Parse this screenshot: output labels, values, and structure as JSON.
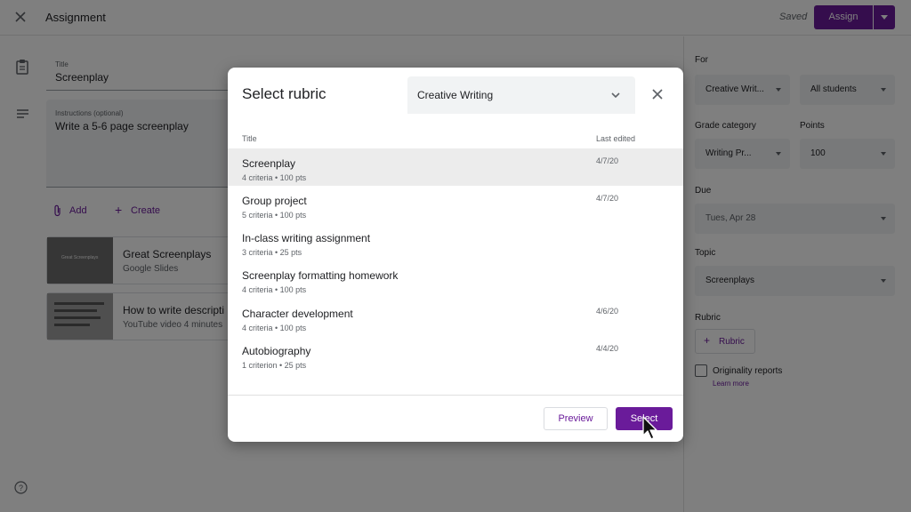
{
  "topbar": {
    "title": "Assignment",
    "saved": "Saved",
    "assign_label": "Assign"
  },
  "form": {
    "title_label": "Title",
    "title_value": "Screenplay",
    "instructions_label": "Instructions (optional)",
    "instructions_value": "Write a 5-6 page screenplay",
    "add_label": "Add",
    "create_label": "Create"
  },
  "attachments": [
    {
      "title": "Great Screenplays",
      "subtitle": "Google Slides",
      "thumb_text": "Great Screenplays"
    },
    {
      "title": "How to write descripti",
      "subtitle": "YouTube video   4 minutes"
    }
  ],
  "right_panel": {
    "for_label": "For",
    "for_class": "Creative Writ...",
    "for_students": "All students",
    "grade_category_label": "Grade category",
    "grade_category_value": "Writing Pr...",
    "points_label": "Points",
    "points_value": "100",
    "due_label": "Due",
    "due_value": "Tues, Apr 28",
    "topic_label": "Topic",
    "topic_value": "Screenplays",
    "rubric_label": "Rubric",
    "rubric_button": "Rubric",
    "originality_label": "Originality reports",
    "learn_more": "Learn more"
  },
  "dialog": {
    "title": "Select rubric",
    "selected_class": "Creative Writing",
    "col_title": "Title",
    "col_last_edited": "Last edited",
    "rows": [
      {
        "name": "Screenplay",
        "meta": "4 criteria • 100 pts",
        "date": "4/7/20"
      },
      {
        "name": "Group project",
        "meta": "5 criteria • 100 pts",
        "date": "4/7/20"
      },
      {
        "name": "In-class writing assignment",
        "meta": "3 criteria • 25 pts",
        "date": ""
      },
      {
        "name": "Screenplay formatting homework",
        "meta": "4 criteria • 100 pts",
        "date": ""
      },
      {
        "name": "Character development",
        "meta": "4 criteria • 100 pts",
        "date": "4/6/20"
      },
      {
        "name": "Autobiography",
        "meta": "1 criterion • 25 pts",
        "date": "4/4/20"
      }
    ],
    "preview_label": "Preview",
    "select_label": "Select"
  },
  "colors": {
    "accent": "#6a1b9a",
    "scrim": "rgba(0,0,0,0.5)"
  }
}
